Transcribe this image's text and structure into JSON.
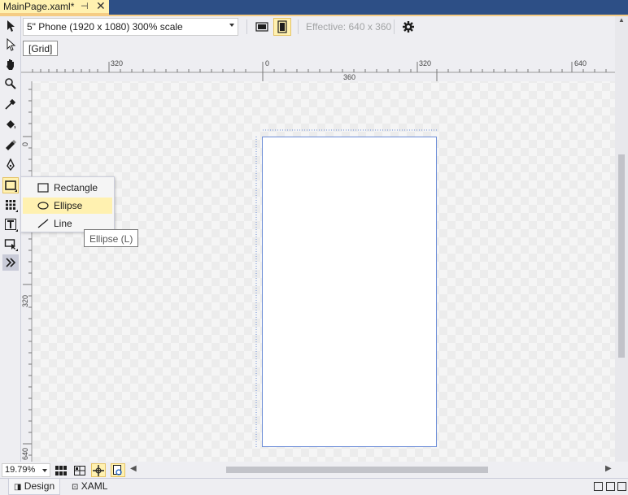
{
  "document": {
    "tab_title": "MainPage.xaml*",
    "pin_glyph": "⊣",
    "close_glyph": "✕"
  },
  "toolbar": {
    "device": "5\" Phone (1920 x 1080) 300% scale",
    "effective": "Effective: 640 x 360",
    "icons": [
      "landscape-icon",
      "portrait-icon",
      "gear-icon"
    ]
  },
  "breadcrumb": "[Grid]",
  "rulers": {
    "horizontal": [
      "320",
      "0",
      "320",
      "640"
    ],
    "horizontal_sub": "360",
    "vertical": [
      "0",
      "640",
      "320",
      "640"
    ]
  },
  "tools": [
    "selection",
    "direct-selection",
    "pan",
    "zoom",
    "eyedropper",
    "paint-bucket",
    "gradient",
    "pen",
    "rectangle",
    "grid-layout",
    "text",
    "control",
    "assets"
  ],
  "flyout": {
    "items": [
      {
        "label": "Rectangle",
        "icon": "rectangle-icon"
      },
      {
        "label": "Ellipse",
        "icon": "ellipse-icon"
      },
      {
        "label": "Line",
        "icon": "line-icon"
      }
    ],
    "highlighted": "Ellipse",
    "tooltip": "Ellipse (L)"
  },
  "statusbar": {
    "zoom": "19.79%"
  },
  "view_tabs": {
    "design": "Design",
    "xaml": "XAML"
  },
  "colors": {
    "tab_strip": "#2d4f86",
    "active_tab": "#fff1b0",
    "selection": "#fff1b0",
    "page_border": "#6d8ed8"
  }
}
